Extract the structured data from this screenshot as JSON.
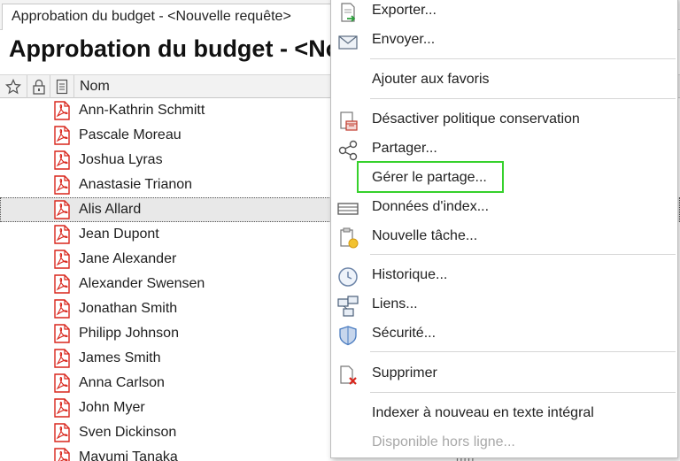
{
  "tab": {
    "title": "Approbation du budget - <Nouvelle requête>"
  },
  "page": {
    "title": "Approbation du budget - <Nouvelle requête>"
  },
  "columns": {
    "name": "Nom"
  },
  "rows": [
    "Ann-Kathrin Schmitt",
    "Pascale Moreau",
    "Joshua Lyras",
    "Anastasie Trianon",
    "Alis Allard",
    "Jean Dupont",
    "Jane Alexander",
    "Alexander Swensen",
    "Jonathan Smith",
    "Philipp Johnson",
    "James Smith",
    "Anna Carlson",
    "John Myer",
    "Sven Dickinson",
    "Mayumi Tanaka"
  ],
  "selected_row": "Alis Allard",
  "right_column_partial": "rrrrr",
  "menu": {
    "export": "Exporter...",
    "send": "Envoyer...",
    "add_favorites": "Ajouter aux favoris",
    "disable_retention": "Désactiver politique conservation",
    "share": "Partager...",
    "manage_share": "Gérer le partage...",
    "index_data": "Données d'index...",
    "new_task": "Nouvelle tâche...",
    "history": "Historique...",
    "links": "Liens...",
    "security": "Sécurité...",
    "delete": "Supprimer",
    "reindex": "Indexer à nouveau en texte intégral",
    "offline": "Disponible hors ligne..."
  },
  "colors": {
    "highlight": "#36d12c",
    "pdf": "#d9261c",
    "accent": "#4a7cc0"
  }
}
